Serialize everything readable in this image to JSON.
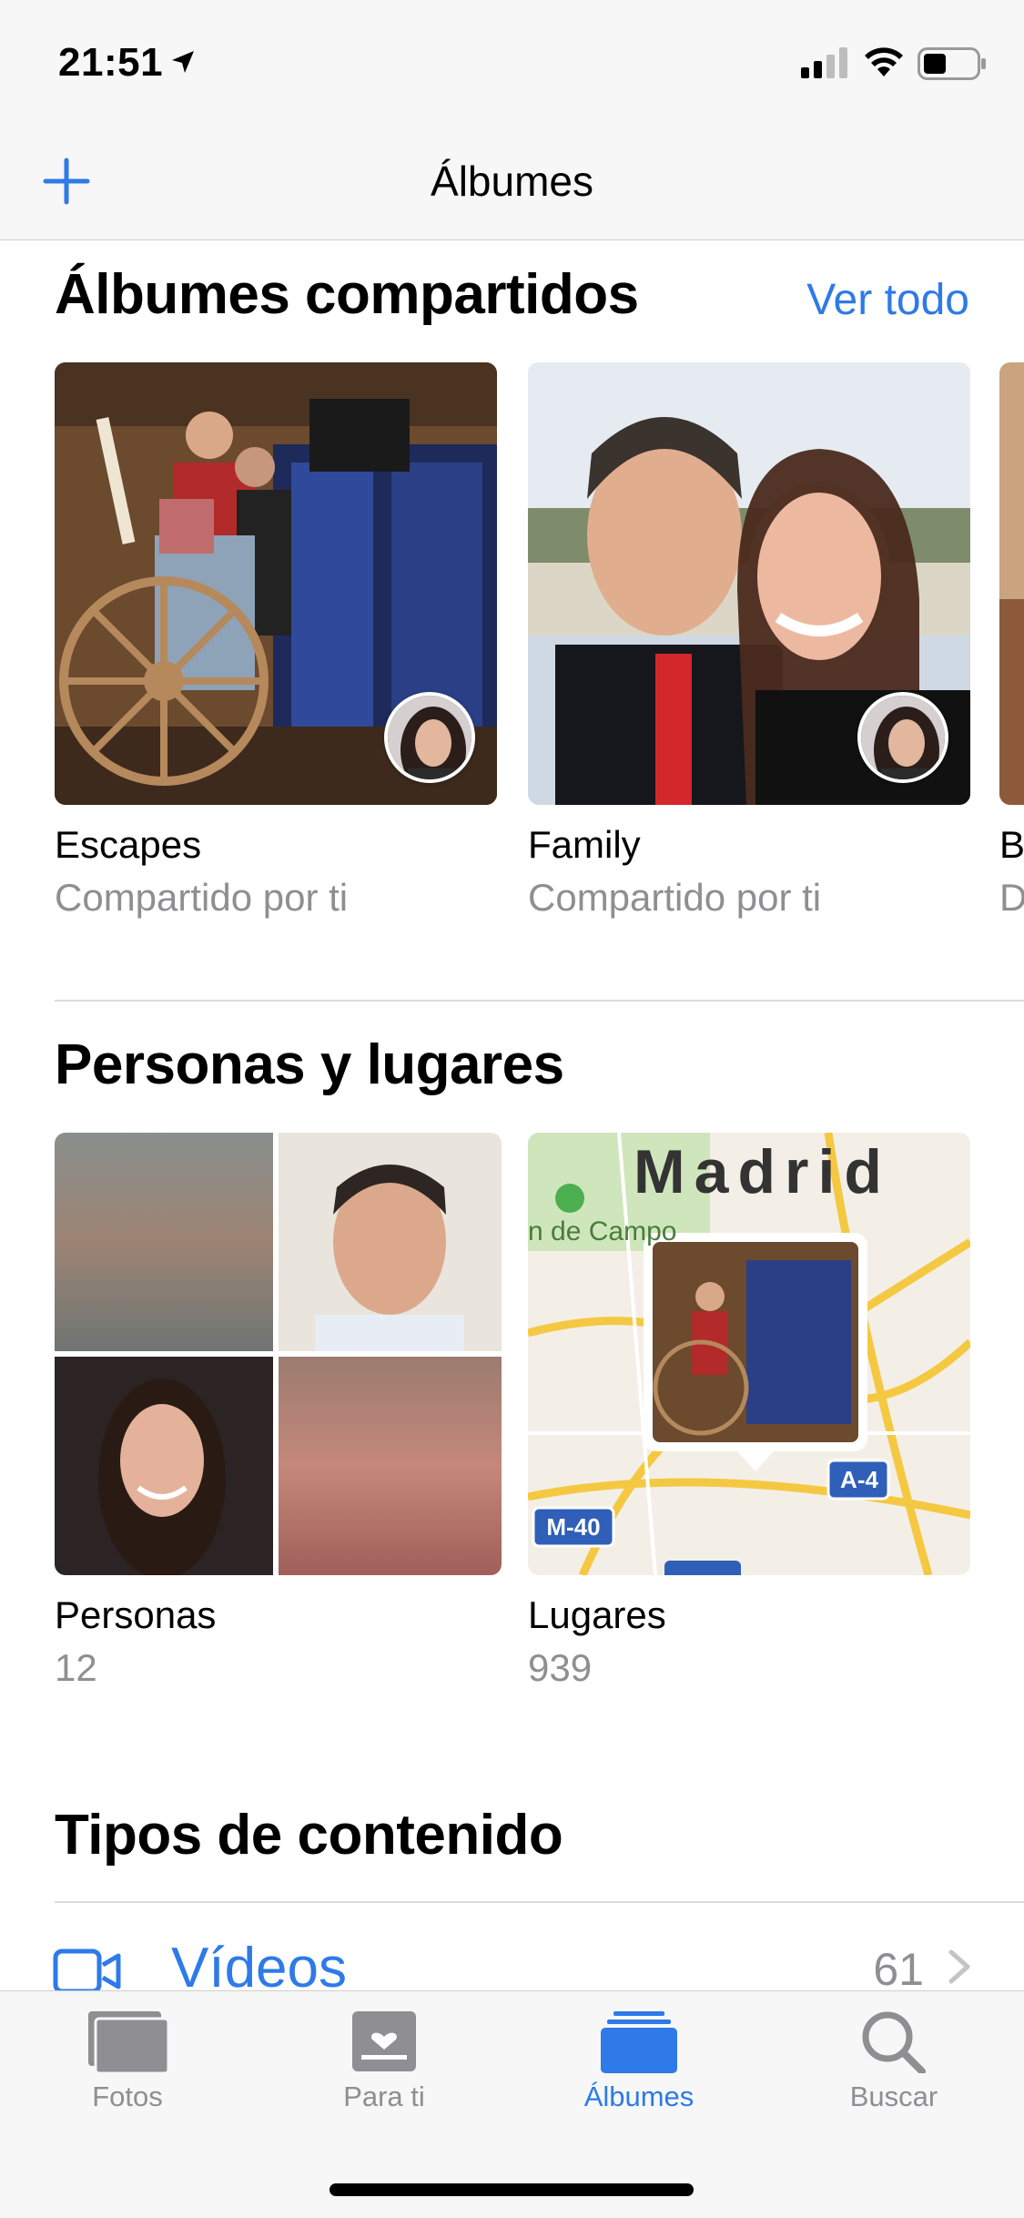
{
  "status_bar": {
    "time": "21:51"
  },
  "nav": {
    "title": "Álbumes",
    "add_icon": "plus-icon"
  },
  "shared_albums": {
    "title": "Álbumes compartidos",
    "see_all": "Ver todo",
    "albums": [
      {
        "name": "Escapes",
        "subtitle": "Compartido por ti"
      },
      {
        "name": "Family",
        "subtitle": "Compartido por ti"
      },
      {
        "name": "B",
        "subtitle": "D"
      }
    ]
  },
  "people_places": {
    "title": "Personas y lugares",
    "people": {
      "label": "Personas",
      "count": "12"
    },
    "places": {
      "label": "Lugares",
      "count": "939",
      "map_city": "Madrid",
      "map_text": "n de Campo",
      "road_a4": "A-4",
      "road_m40": "M-40"
    }
  },
  "media_types": {
    "title": "Tipos de contenido",
    "items": [
      {
        "label": "Vídeos",
        "count": "61",
        "icon": "video-camera-icon"
      }
    ]
  },
  "tab_bar": {
    "tabs": [
      {
        "label": "Fotos",
        "icon": "photos-icon",
        "active": false
      },
      {
        "label": "Para ti",
        "icon": "for-you-icon",
        "active": false
      },
      {
        "label": "Álbumes",
        "icon": "albums-icon",
        "active": true
      },
      {
        "label": "Buscar",
        "icon": "search-icon",
        "active": false
      }
    ]
  },
  "colors": {
    "accent": "#2e7ae8",
    "secondary_text": "#8e8e93",
    "map_road": "#f7c948",
    "map_park": "#c8e6b0"
  }
}
